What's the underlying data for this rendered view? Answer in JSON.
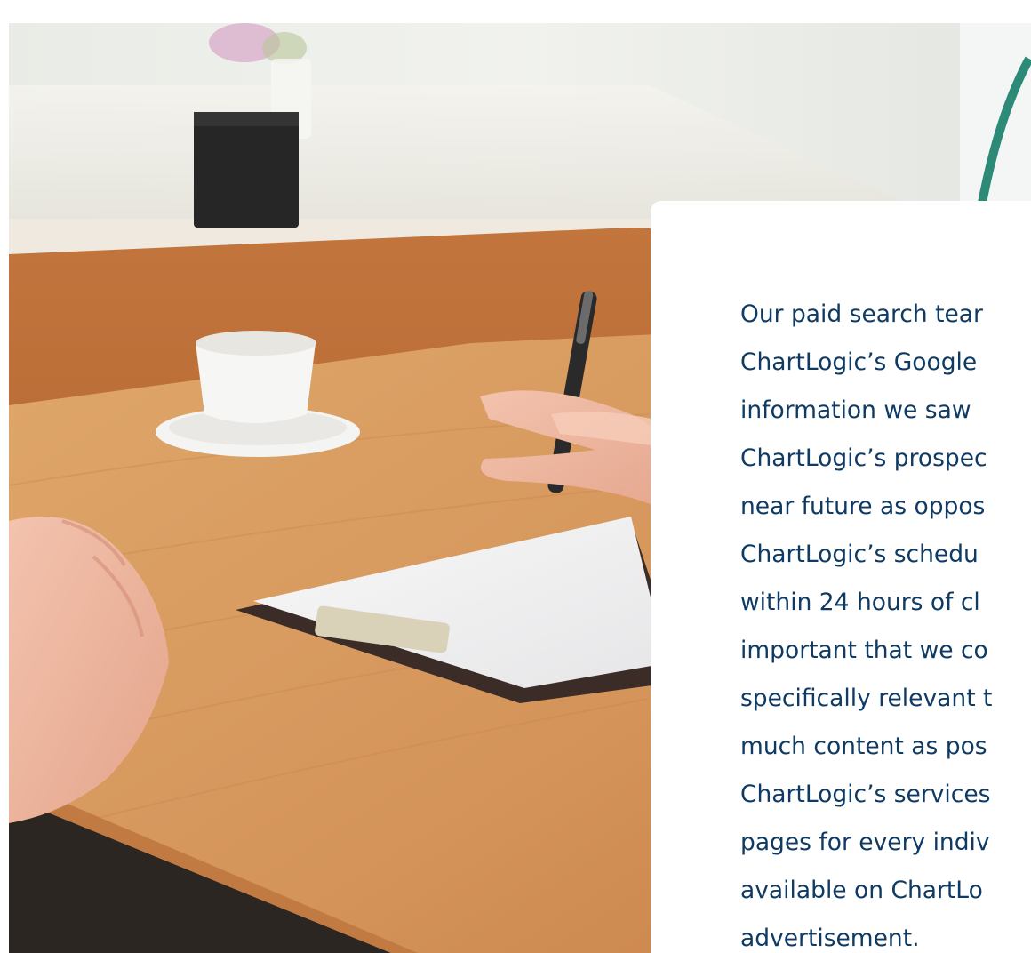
{
  "photo": {
    "alt": "Doctor consulting with patient at a wooden desk with clipboard and coffee cup"
  },
  "card": {
    "lines": [
      "Our paid search tear",
      "ChartLogic’s Google",
      "information we saw",
      "ChartLogic’s prospec",
      "near future as oppos",
      "ChartLogic’s schedu",
      "within 24 hours of cl",
      "important that we co",
      "specifically relevant t",
      "much content as pos",
      "ChartLogic’s services",
      "pages for every indiv",
      "available on ChartLo",
      "advertisement."
    ]
  },
  "colors": {
    "text": "#0f3a63",
    "card_bg": "#ffffff",
    "wall": "#eceeea",
    "desk": "#d79a5c",
    "desk_edge": "#b9733c"
  }
}
